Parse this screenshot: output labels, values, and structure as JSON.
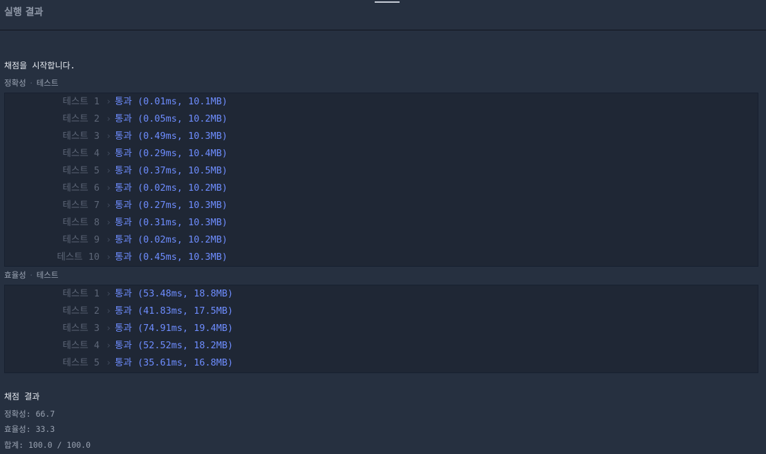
{
  "header": {
    "title": "실행 결과"
  },
  "start_message": "채점을 시작합니다.",
  "accuracy_section": {
    "label": "정확성",
    "sub_label": "테스트",
    "tests": [
      {
        "name": "테스트 1",
        "result": "통과 (0.01ms, 10.1MB)"
      },
      {
        "name": "테스트 2",
        "result": "통과 (0.05ms, 10.2MB)"
      },
      {
        "name": "테스트 3",
        "result": "통과 (0.49ms, 10.3MB)"
      },
      {
        "name": "테스트 4",
        "result": "통과 (0.29ms, 10.4MB)"
      },
      {
        "name": "테스트 5",
        "result": "통과 (0.37ms, 10.5MB)"
      },
      {
        "name": "테스트 6",
        "result": "통과 (0.02ms, 10.2MB)"
      },
      {
        "name": "테스트 7",
        "result": "통과 (0.27ms, 10.3MB)"
      },
      {
        "name": "테스트 8",
        "result": "통과 (0.31ms, 10.3MB)"
      },
      {
        "name": "테스트 9",
        "result": "통과 (0.02ms, 10.2MB)"
      },
      {
        "name": "테스트 10",
        "result": "통과 (0.45ms, 10.3MB)"
      }
    ]
  },
  "efficiency_section": {
    "label": "효율성",
    "sub_label": "테스트",
    "tests": [
      {
        "name": "테스트 1",
        "result": "통과 (53.48ms, 18.8MB)"
      },
      {
        "name": "테스트 2",
        "result": "통과 (41.83ms, 17.5MB)"
      },
      {
        "name": "테스트 3",
        "result": "통과 (74.91ms, 19.4MB)"
      },
      {
        "name": "테스트 4",
        "result": "통과 (52.52ms, 18.2MB)"
      },
      {
        "name": "테스트 5",
        "result": "통과 (35.61ms, 16.8MB)"
      }
    ]
  },
  "summary": {
    "title": "채점 결과",
    "accuracy": "정확성: 66.7",
    "efficiency": "효율성: 33.3",
    "total": "합계: 100.0 / 100.0"
  },
  "colors": {
    "background": "#263040",
    "box_background": "#1f2735",
    "pass_text": "#6e8dff",
    "test_name": "#5d6677"
  },
  "icons": {
    "row_separator": "chevron-right-icon"
  }
}
